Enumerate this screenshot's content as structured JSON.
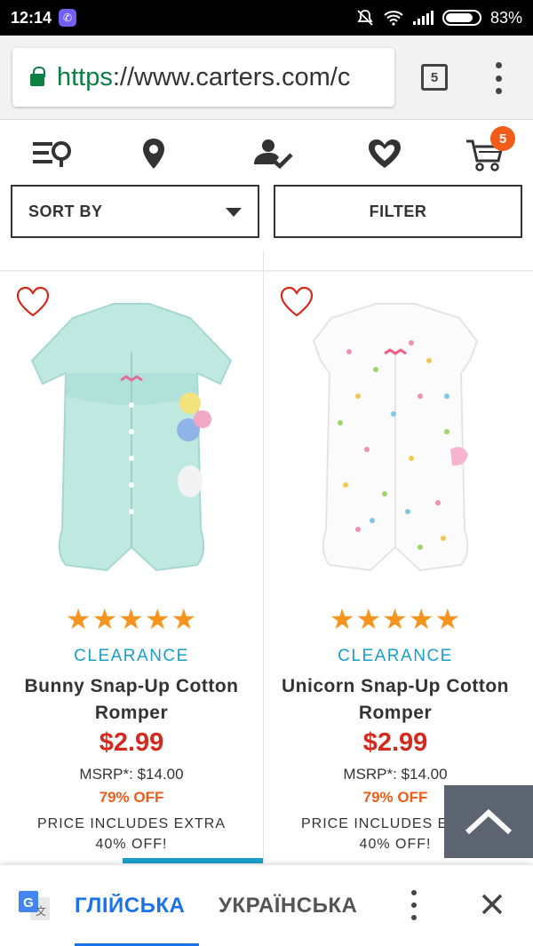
{
  "status_bar": {
    "time": "12:14",
    "battery": "83%"
  },
  "browser": {
    "url_scheme": "https",
    "url_rest": "://www.carters.com/c",
    "tab_count": "5"
  },
  "site_nav": {
    "icons": [
      "list-search-icon",
      "location-pin-icon",
      "account-check-icon",
      "heart-icon",
      "cart-icon"
    ],
    "cart_count": "5"
  },
  "controls": {
    "sort_label": "SORT BY",
    "filter_label": "FILTER"
  },
  "products": [
    {
      "name": "Bunny Snap-Up Cotton Romper",
      "badge": "CLEARANCE",
      "rating_stars": 5,
      "stars_text": "★★★★★",
      "price": "$2.99",
      "msrp": "MSRP*: $14.00",
      "percent_off": "79% OFF",
      "promo": "PRICE INCLUDES EXTRA 40% OFF!",
      "color": "#bfe8e1"
    },
    {
      "name": "Unicorn Snap-Up Cotton Romper",
      "badge": "CLEARANCE",
      "rating_stars": 5,
      "stars_text": "★★★★★",
      "price": "$2.99",
      "msrp": "MSRP*: $14.00",
      "percent_off": "79% OFF",
      "promo": "PRICE INCLUDES EXTRA 40% OFF!",
      "color": "#fbfbfb"
    }
  ],
  "translate_bar": {
    "source_language": "ГЛІЙСЬКА",
    "target_language": "УКРАЇНСЬКА"
  },
  "colors": {
    "accent_blue": "#1a9fc9",
    "price_red": "#d42a1e",
    "discount_orange": "#f25c19",
    "star_orange": "#f7941d"
  }
}
